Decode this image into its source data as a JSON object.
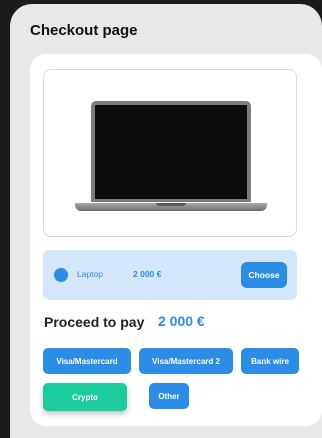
{
  "page": {
    "title": "Checkout page"
  },
  "product": {
    "name": "Laptop",
    "price": "2 000 €",
    "choose_label": "Choose"
  },
  "proceed": {
    "label": "Proceed to pay",
    "amount": "2 000 €"
  },
  "payment_methods": [
    {
      "label": "Visa/Mastercard",
      "selected": false
    },
    {
      "label": "Visa/Mastercard 2",
      "selected": false
    },
    {
      "label": "Bank wire",
      "selected": false
    },
    {
      "label": "Crypto",
      "selected": true
    },
    {
      "label": "Other",
      "selected": false
    }
  ],
  "colors": {
    "accent": "#2b8de5",
    "selected": "#1dcc9c",
    "product_row_bg": "#d4e6f9",
    "panel_bg": "#e8e8e8",
    "outer_bg": "#1b1b1b"
  }
}
